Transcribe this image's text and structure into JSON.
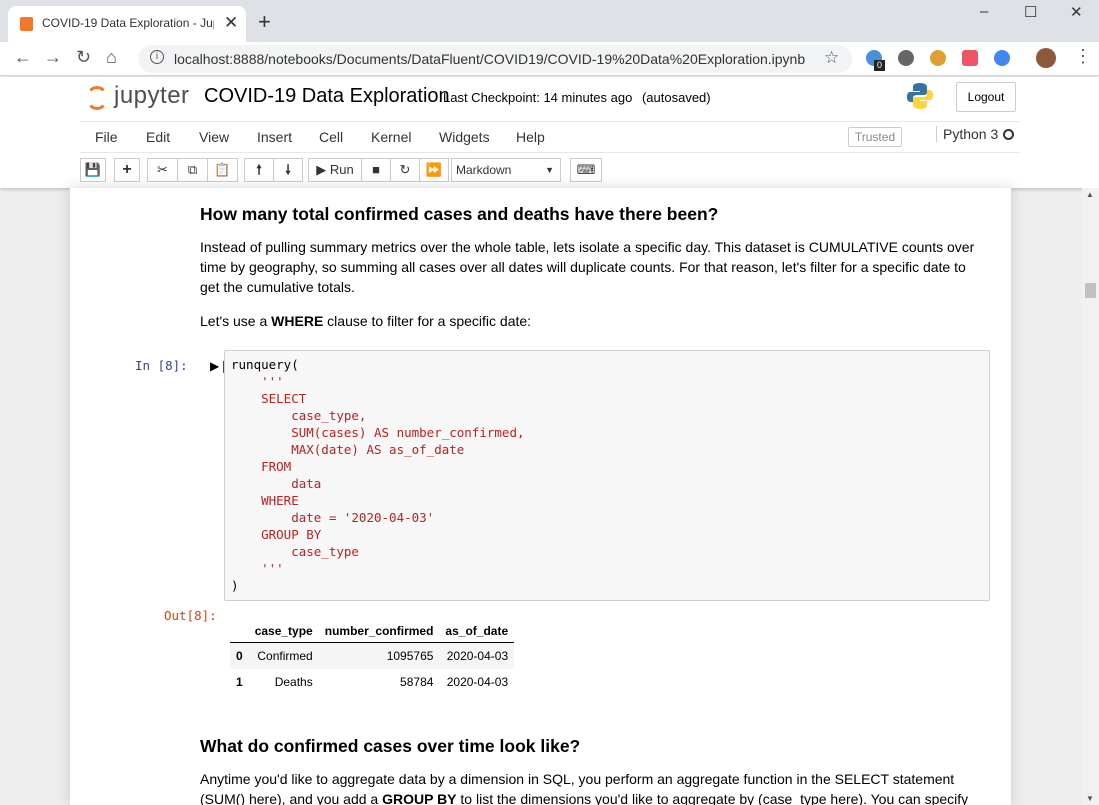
{
  "browser": {
    "tab_title": "COVID-19 Data Exploration - Jup",
    "url": "localhost:8888/notebooks/Documents/DataFluent/COVID19/COVID-19%20Data%20Exploration.ipynb",
    "new_tab_glyph": "+",
    "minimize_glyph": "–",
    "maximize_glyph": "☐",
    "close_glyph": "✕",
    "extension_badge": "0"
  },
  "jupyter": {
    "logo_text": "jupyter",
    "notebook_title": "COVID-19 Data Exploration",
    "checkpoint": "Last Checkpoint: 14 minutes ago",
    "autosave": "(autosaved)",
    "logout_label": "Logout",
    "menus": [
      "File",
      "Edit",
      "View",
      "Insert",
      "Cell",
      "Kernel",
      "Widgets",
      "Help"
    ],
    "trusted_label": "Trusted",
    "kernel_name": "Python 3",
    "run_label": "Run",
    "cell_type": "Markdown"
  },
  "cells": {
    "heading1": "How many total confirmed cases and deaths have there been?",
    "para1": "Instead of pulling summary metrics over the whole table, lets isolate a specific day. This dataset is CUMULATIVE counts over time by geography, so summing all cases over all dates will duplicate counts. For that reason, let's filter for a specific date to get the cumulative totals.",
    "para2_pre": "Let's use a ",
    "para2_bold": "WHERE",
    "para2_post": " clause to filter for a specific date:",
    "in_prompt": "In [8]:",
    "out_prompt": "Out[8]:",
    "code_lines": {
      "l1": "runquery(",
      "l2": "    '''",
      "l3": "    SELECT",
      "l4": "        case_type,",
      "l5": "        SUM(cases) AS number_confirmed,",
      "l6": "        MAX(date) AS as_of_date",
      "l7": "    FROM",
      "l8": "        data",
      "l9": "    WHERE",
      "l10": "        date = '2020-04-03'",
      "l11": "    GROUP BY",
      "l12": "        case_type",
      "l13": "    '''",
      "l14": ")"
    },
    "output_table": {
      "headers": [
        "",
        "case_type",
        "number_confirmed",
        "as_of_date"
      ],
      "rows": [
        [
          "0",
          "Confirmed",
          "1095765",
          "2020-04-03"
        ],
        [
          "1",
          "Deaths",
          "58784",
          "2020-04-03"
        ]
      ]
    },
    "heading2": "What do confirmed cases over time look like?",
    "para3_line1": "Anytime you'd like to aggregate data by a dimension in SQL, you perform an aggregate function in the SELECT statement",
    "para3_line2_pre": "(SUM() here), and you add a ",
    "para3_line2_bold": "GROUP BY",
    "para3_line2_post": " to list the dimensions you'd like to aggregate by (case_type here). You can specify"
  },
  "colors": {
    "jupyter_orange": "#f37726",
    "code_string_red": "#ba2121",
    "prompt_in_blue": "#303f9f",
    "prompt_out_red": "#d84315"
  }
}
